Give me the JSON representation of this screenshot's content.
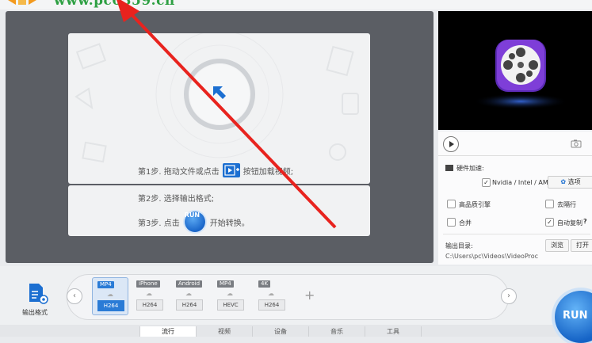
{
  "watermark": "www.pc0359.cn",
  "steps": {
    "step1_prefix": "第1步. 拖动文件或点击",
    "step1_suffix": "按钮加载视频;",
    "step2": "第2步. 选择输出格式;",
    "step3_prefix": "第3步. 点击",
    "step3_run": "RUN",
    "step3_suffix": "开始转换。"
  },
  "options": {
    "hw_accel_label": "硬件加速:",
    "nvidia_label": "Nvidia / Intel / AMD",
    "nvidia_checked": true,
    "settings_label": "选项",
    "quality_engine_label": "高品质引擎",
    "deinterlace_label": "去隔行",
    "merge_label": "合并",
    "autocopy_label": "自动复制",
    "autocopy_checked": true,
    "output_dir_label": "输出目录:",
    "output_path": "C:\\Users\\pc\\Videos\\VideoProc",
    "browse_label": "浏览",
    "open_label": "打开"
  },
  "output_format_label": "输出格式",
  "formats": [
    {
      "top": "MP4",
      "bottom": "H264",
      "active": true
    },
    {
      "top": "iPhone",
      "bottom": "H264",
      "active": false
    },
    {
      "top": "Android",
      "bottom": "H264",
      "active": false
    },
    {
      "top": "MP4",
      "bottom": "HEVC",
      "active": false
    },
    {
      "top": "4K",
      "bottom": "H264",
      "active": false
    }
  ],
  "tabs": [
    "流行",
    "视频",
    "设备",
    "音乐",
    "工具"
  ],
  "run_label": "RUN",
  "colors": {
    "accent": "#1c6fd1",
    "arrow": "#e8231e",
    "watermark": "#2ea043"
  }
}
